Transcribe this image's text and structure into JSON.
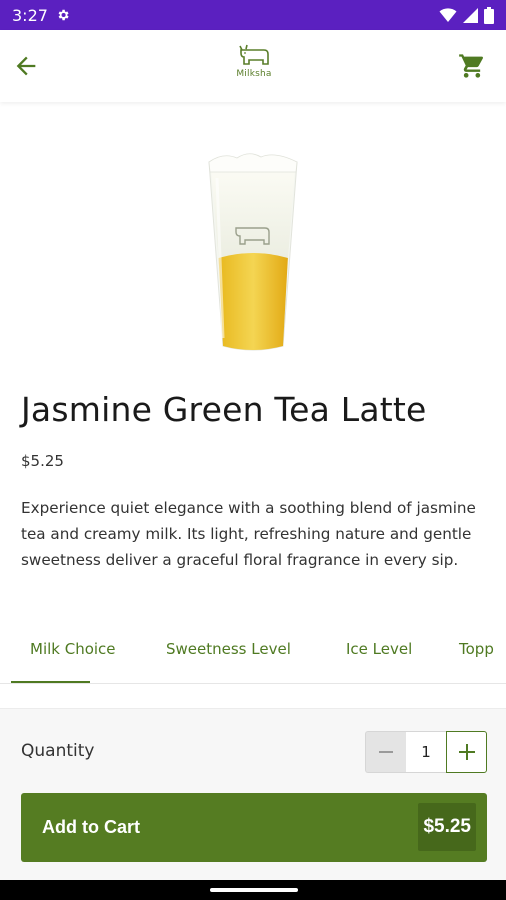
{
  "status_bar": {
    "time": "3:27"
  },
  "header": {
    "logo_text": "Milksha"
  },
  "product": {
    "name": "Jasmine Green Tea Latte",
    "price": "$5.25",
    "description": "Experience quiet elegance with a soothing blend of jasmine tea and creamy milk. Its light, refreshing nature and gentle sweetness deliver a graceful floral fragrance in every sip."
  },
  "tabs": [
    {
      "label": "Milk Choice",
      "selected": true
    },
    {
      "label": "Sweetness Level",
      "selected": false
    },
    {
      "label": "Ice Level",
      "selected": false
    },
    {
      "label": "Topp",
      "selected": false
    }
  ],
  "quantity": {
    "label": "Quantity",
    "value": "1"
  },
  "add_to_cart": {
    "label": "Add to Cart",
    "price": "$5.25"
  },
  "colors": {
    "status_bar": "#5b20c0",
    "accent_green": "#557c22",
    "accent_green_dark": "#46681b",
    "tab_text": "#4f7a22"
  },
  "icons": [
    "settings-icon",
    "wifi-icon",
    "signal-icon",
    "battery-icon",
    "back-arrow-icon",
    "milksha-cow-logo",
    "cart-icon",
    "minus-icon",
    "plus-icon"
  ]
}
